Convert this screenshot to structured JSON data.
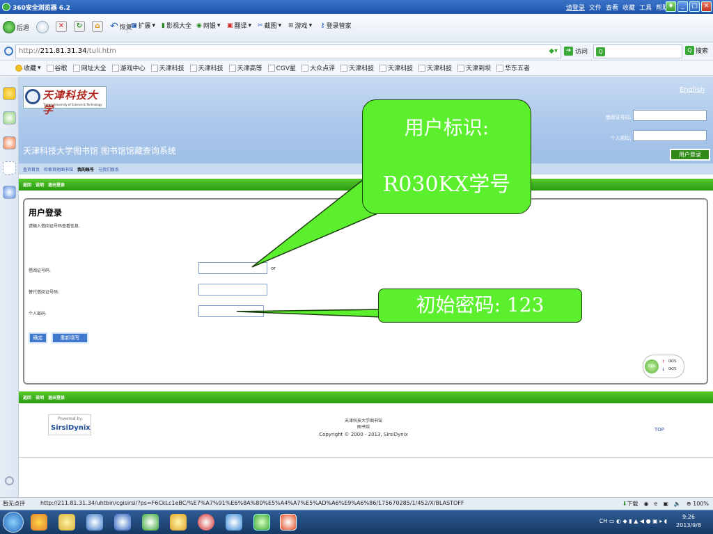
{
  "browser": {
    "title": "360安全浏览器 6.2",
    "top_menu": {
      "login": "请登录",
      "items": [
        "文件",
        "查看",
        "收藏",
        "工具",
        "帮助"
      ]
    },
    "toolbar": {
      "back": "后退",
      "restore": "恢复",
      "extend": "扩展",
      "video": "影视大全",
      "netbank": "网银",
      "translate": "翻译",
      "screenshot": "截图",
      "game": "游戏",
      "login_mgr": "登录管家"
    },
    "address": {
      "proto": "http://",
      "host": "211.81.31.34",
      "path": "/tuli.htm",
      "go_label": "访问",
      "search_label": "搜索"
    },
    "favorites": {
      "label": "收藏",
      "items": [
        "谷歌",
        "网址大全",
        "游戏中心",
        "天津科技",
        "天津科技",
        "天津高等",
        "CGV星",
        "大众点评",
        "天津科技",
        "天津科技",
        "天津科技",
        "天津到坝",
        "华东五者"
      ]
    },
    "status": {
      "left": "暂无点评",
      "url": "http://211.81.31.34/uhtbin/cgisirsi/?ps=F6CkLc1eBC/%E7%A7%91%E6%8A%80%E5%A4%A7%E5%AD%A6%E9%A6%86/175670285/1/452/X/BLASTOFF",
      "download": "下载",
      "zoom": "100%"
    }
  },
  "site": {
    "logo_name": "天津科技大学",
    "logo_eng": "Tianjin University of Science & Technology",
    "english_link": "English",
    "card_label": "借阅证号码:",
    "pwd_label": "个人密码:",
    "login_button": "用户登录",
    "title": "天津科技大学图书馆 图书馆馆藏查询系统",
    "nav": [
      "查询首页",
      "检索其他图书馆",
      "我的账号",
      "与我们联系"
    ],
    "nav_active_index": 2,
    "greenbar": [
      "返回",
      "说明",
      "退出登录"
    ]
  },
  "form": {
    "heading": "用户登录",
    "subheading": "请输入借阅证号码查看信息.",
    "card_label": "借阅证号码:",
    "alt_card_label": "替代借阅证号码:",
    "pwd_label": "个人密码:",
    "or_text": "or",
    "confirm": "确定",
    "reset": "重新填写"
  },
  "speed": {
    "percent": "53%",
    "up": "0K/S",
    "down": "0K/S"
  },
  "footer": {
    "powered_by": "Powered by",
    "brand": "SirsiDynix",
    "line1": "天津科技大学图书馆",
    "line2": "图书馆",
    "copyright": "Copyright © 2000 - 2013, SirsiDynix",
    "top": "TOP"
  },
  "callouts": {
    "user_id_line1": "用户标识:",
    "user_id_line2": "R030KX学号",
    "password": "初始密码: 123"
  },
  "taskbar": {
    "lang": "CH",
    "time": "9:26",
    "date": "2013/9/8"
  },
  "colors": {
    "callout_green": "#5bef2d",
    "site_green": "#2a9a10",
    "header_blue": "#a9c6eb"
  }
}
